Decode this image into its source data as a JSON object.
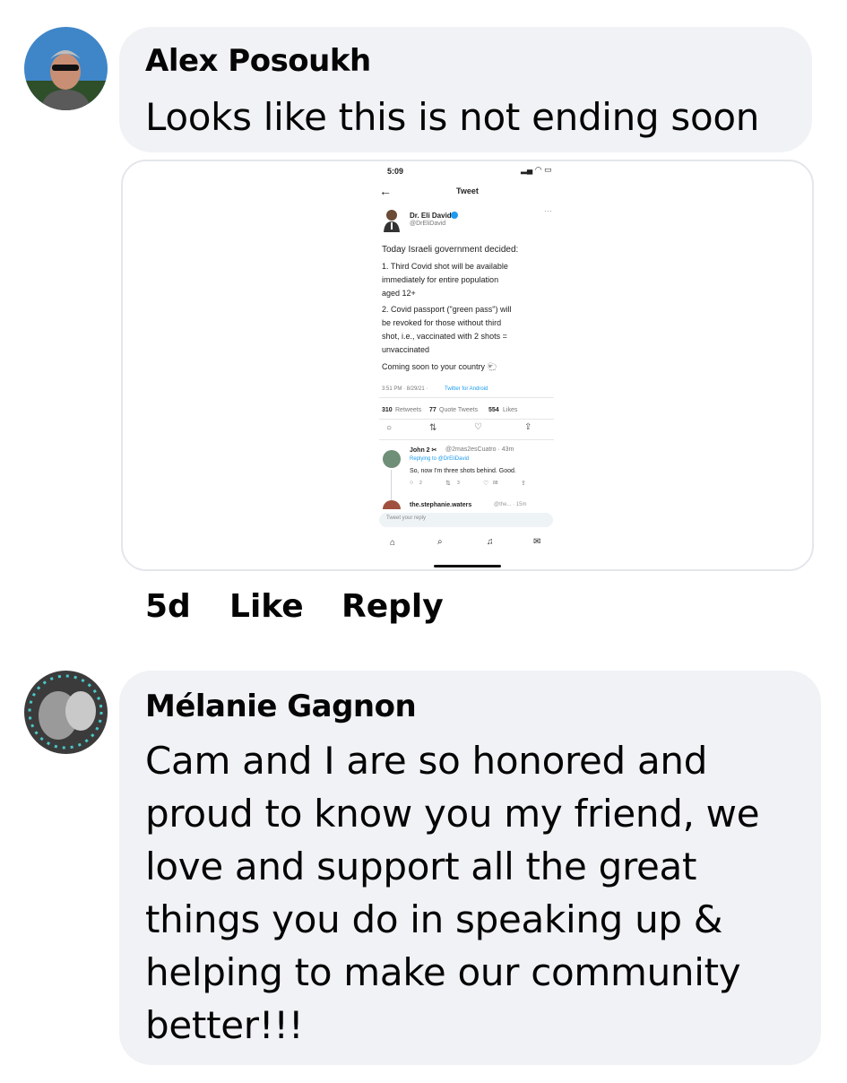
{
  "comments": [
    {
      "author": "Alex Posoukh",
      "text": "Looks like this is not ending soon",
      "attachment": {
        "status_time": "5:09",
        "header_title": "Tweet",
        "tweet_author_name": "Dr. Eli David",
        "tweet_author_handle": "@DrEliDavid",
        "tweet_lines": [
          "Today Israeli government decided:",
          "1. Third Covid shot will be available",
          "immediately for entire population",
          "aged 12+",
          "2. Covid passport (\"green pass\") will",
          "be revoked for those without third",
          "shot, i.e., vaccinated with 2 shots =",
          "unvaccinated",
          "Coming soon to your country 🐑"
        ],
        "tweet_time": "3:51 PM · 8/29/21 ·",
        "tweet_source": "Twitter for Android",
        "retweets_count": "310",
        "retweets_label": "Retweets",
        "quote_count": "77",
        "quote_label": "Quote Tweets",
        "likes_count": "554",
        "likes_label": "Likes",
        "reply1_author": "John 2 ✂",
        "reply1_handle_time": "@2mas2esCuatro · 43m",
        "reply1_replying": "Replying to @DrEliDavid",
        "reply1_text": "So, now I'm three shots behind. Good.",
        "reply1_replies": "2",
        "reply1_retweets": "3",
        "reply1_likes": "88",
        "reply2_author": "the.stephanie.waters",
        "reply2_handle_time": "@the... · 15m",
        "reply_placeholder": "Tweet your reply"
      },
      "age": "5d",
      "like_label": "Like",
      "reply_label": "Reply"
    },
    {
      "author": "Mélanie Gagnon",
      "text_lines": [
        "Cam and I are so honored and",
        "proud to know you my friend, we",
        "love and support all the great",
        "things you do in speaking up &",
        "helping to make our community",
        "better!!!"
      ]
    }
  ],
  "colors": {
    "bubble": "#f0f2f5",
    "twitter_blue": "#1d9bf0",
    "text": "#050505"
  }
}
